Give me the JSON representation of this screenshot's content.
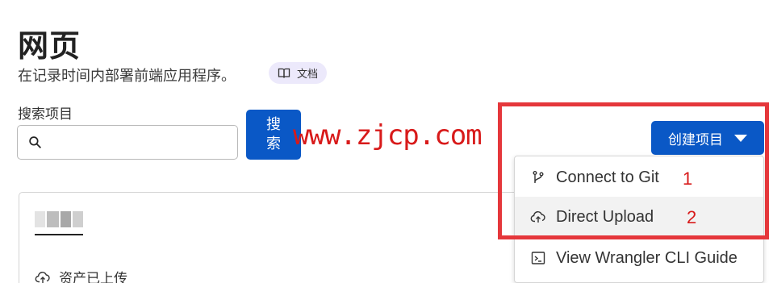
{
  "header": {
    "title": "网页",
    "subtitle": "在记录时间内部署前端应用程序。",
    "docs_label": "文档"
  },
  "search": {
    "label": "搜索项目",
    "value": "",
    "button_line1": "搜",
    "button_line2": "索"
  },
  "watermark": "www.zjcp.com",
  "create": {
    "label": "创建项目"
  },
  "dropdown": {
    "items": [
      {
        "label": "Connect to Git",
        "icon": "git-branch-icon",
        "highlighted": false
      },
      {
        "label": "Direct Upload",
        "icon": "cloud-upload-icon",
        "highlighted": true
      },
      {
        "label": "View Wrangler CLI Guide",
        "icon": "terminal-icon",
        "highlighted": false
      }
    ]
  },
  "annotations": {
    "one": "1",
    "two": "2",
    "color": "#e5373b"
  },
  "project_card": {
    "status": "资产已上传"
  },
  "colors": {
    "accent": "#0a58c6",
    "badge_bg": "#ece9fb",
    "watermark": "#d81a1a"
  }
}
